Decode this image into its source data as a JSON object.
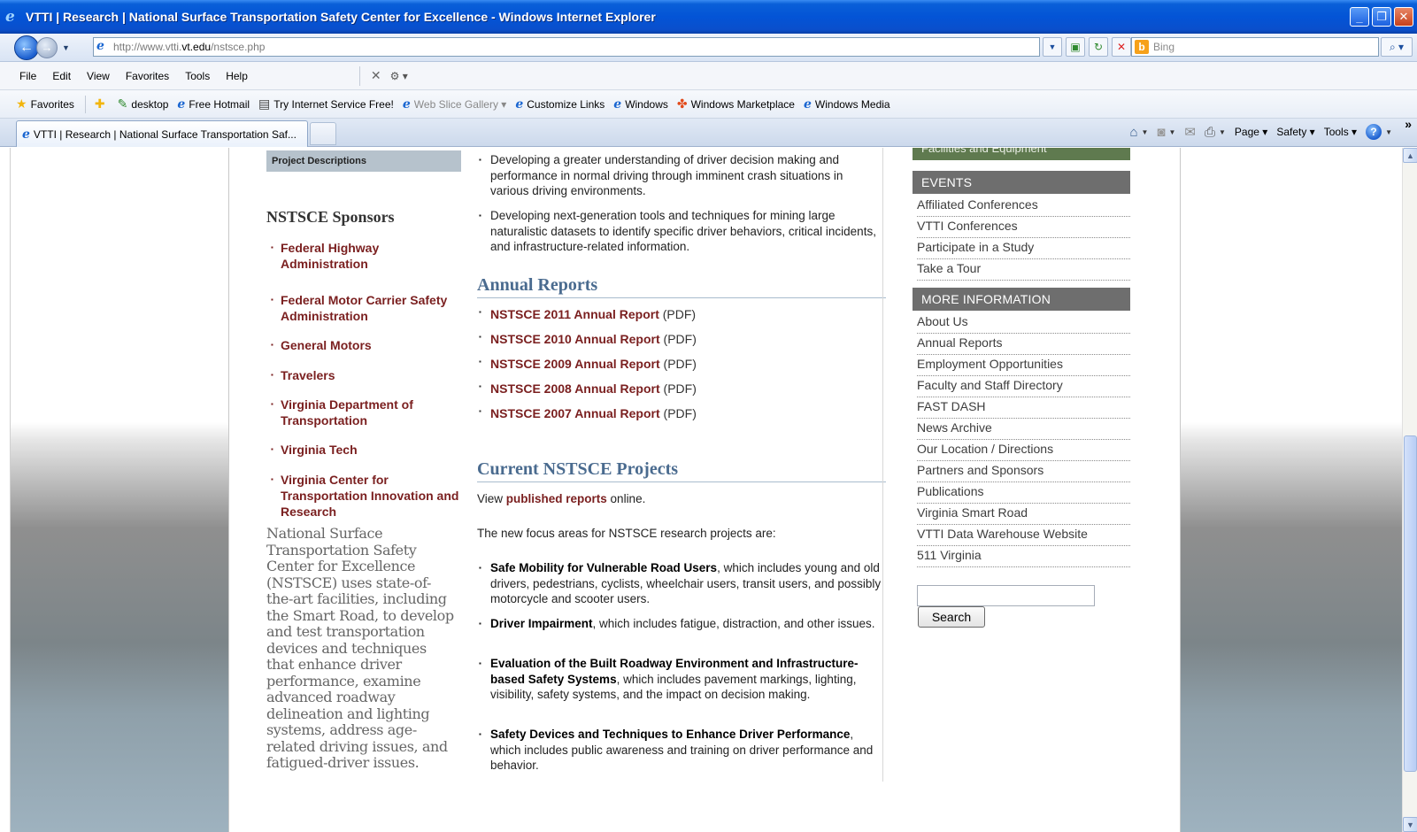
{
  "window": {
    "title": "VTTI | Research | National Surface Transportation Safety Center for Excellence - Windows Internet Explorer",
    "min": "_",
    "max": "❐",
    "close": "✕"
  },
  "address": {
    "prefix": "http://www.vtti.",
    "domain": "vt.edu",
    "path": "/nstsce.php"
  },
  "search": {
    "placeholder": "Bing"
  },
  "menu": [
    "File",
    "Edit",
    "View",
    "Favorites",
    "Tools",
    "Help"
  ],
  "favorites": {
    "label": "Favorites",
    "items": [
      {
        "label": "desktop"
      },
      {
        "label": "Free Hotmail"
      },
      {
        "label": "Try Internet Service Free!"
      },
      {
        "label": "Web Slice Gallery ▾"
      },
      {
        "label": "Customize Links"
      },
      {
        "label": "Windows"
      },
      {
        "label": "Windows Marketplace"
      },
      {
        "label": "Windows Media"
      }
    ]
  },
  "tab": {
    "title": "VTTI | Research | National Surface Transportation Saf..."
  },
  "command_bar": {
    "page": "Page ▾",
    "safety": "Safety ▾",
    "tools": "Tools ▾"
  },
  "left": {
    "project_descriptions": "Project Descriptions",
    "sponsors_title": "NSTSCE Sponsors",
    "sponsors": [
      "Federal Highway Administration",
      "Federal Motor Carrier Safety Administration",
      "General Motors",
      "Travelers",
      "Virginia Department of Transportation",
      "Virginia Tech",
      "Virginia Center for Transportation Innovation and Research"
    ],
    "intro": "National Surface Transportation Safety Center for Excellence (NSTSCE) uses state-of-the-art facilities, including the Smart Road, to develop and test transportation devices and techniques that enhance driver performance, examine advanced roadway delineation and lighting systems, address age-related driving issues, and fatigued-driver issues."
  },
  "main": {
    "top_bullets": [
      "Developing a greater understanding of driver decision making and performance in normal driving through imminent crash situations in various driving environments.",
      "Developing next-generation tools and techniques for mining large naturalistic datasets to identify specific driver behaviors, critical incidents, and infrastructure-related information."
    ],
    "annual_reports_title": "Annual Reports",
    "reports": [
      {
        "label": "NSTSCE 2011 Annual Report",
        "suffix": " (PDF)"
      },
      {
        "label": "NSTSCE 2010 Annual Report",
        "suffix": " (PDF)"
      },
      {
        "label": "NSTSCE 2009 Annual Report",
        "suffix": " (PDF)"
      },
      {
        "label": "NSTSCE 2008 Annual Report",
        "suffix": " (PDF)"
      },
      {
        "label": "NSTSCE 2007 Annual Report",
        "suffix": " (PDF)"
      }
    ],
    "current_title": "Current NSTSCE Projects",
    "view_pre": "View ",
    "view_link": "published reports",
    "view_post": " online.",
    "focus_intro": "The new focus areas for NSTSCE research projects are:",
    "focus": [
      {
        "bold": "Safe Mobility for Vulnerable Road Users",
        "rest": ", which includes young and old drivers, pedestrians, cyclists, wheelchair users, transit users, and possibly motorcycle and scooter users."
      },
      {
        "bold": "Driver Impairment",
        "rest": ", which includes fatigue, distraction, and other issues."
      },
      {
        "bold": "Evaluation of the Built Roadway Environment and Infrastructure-based Safety Systems",
        "rest": ", which includes pavement markings, lighting, visibility, safety systems, and the impact on decision making."
      },
      {
        "bold": "Safety Devices and Techniques to Enhance Driver Performance",
        "rest": ", which includes public awareness and training on driver performance and behavior."
      }
    ]
  },
  "right": {
    "facilities": "Facilities and Equipment",
    "events_title": "EVENTS",
    "events": [
      "Affiliated Conferences",
      "VTTI Conferences",
      "Participate in a Study",
      "Take a Tour"
    ],
    "more_title": "MORE INFORMATION",
    "more": [
      "About Us",
      "Annual Reports",
      "Employment Opportunities",
      "Faculty and Staff Directory",
      "FAST DASH",
      "News Archive",
      "Our Location / Directions",
      "Partners and Sponsors",
      "Publications",
      "Virginia Smart Road",
      "VTTI Data Warehouse Website",
      "511 Virginia"
    ],
    "search_button": "Search"
  }
}
